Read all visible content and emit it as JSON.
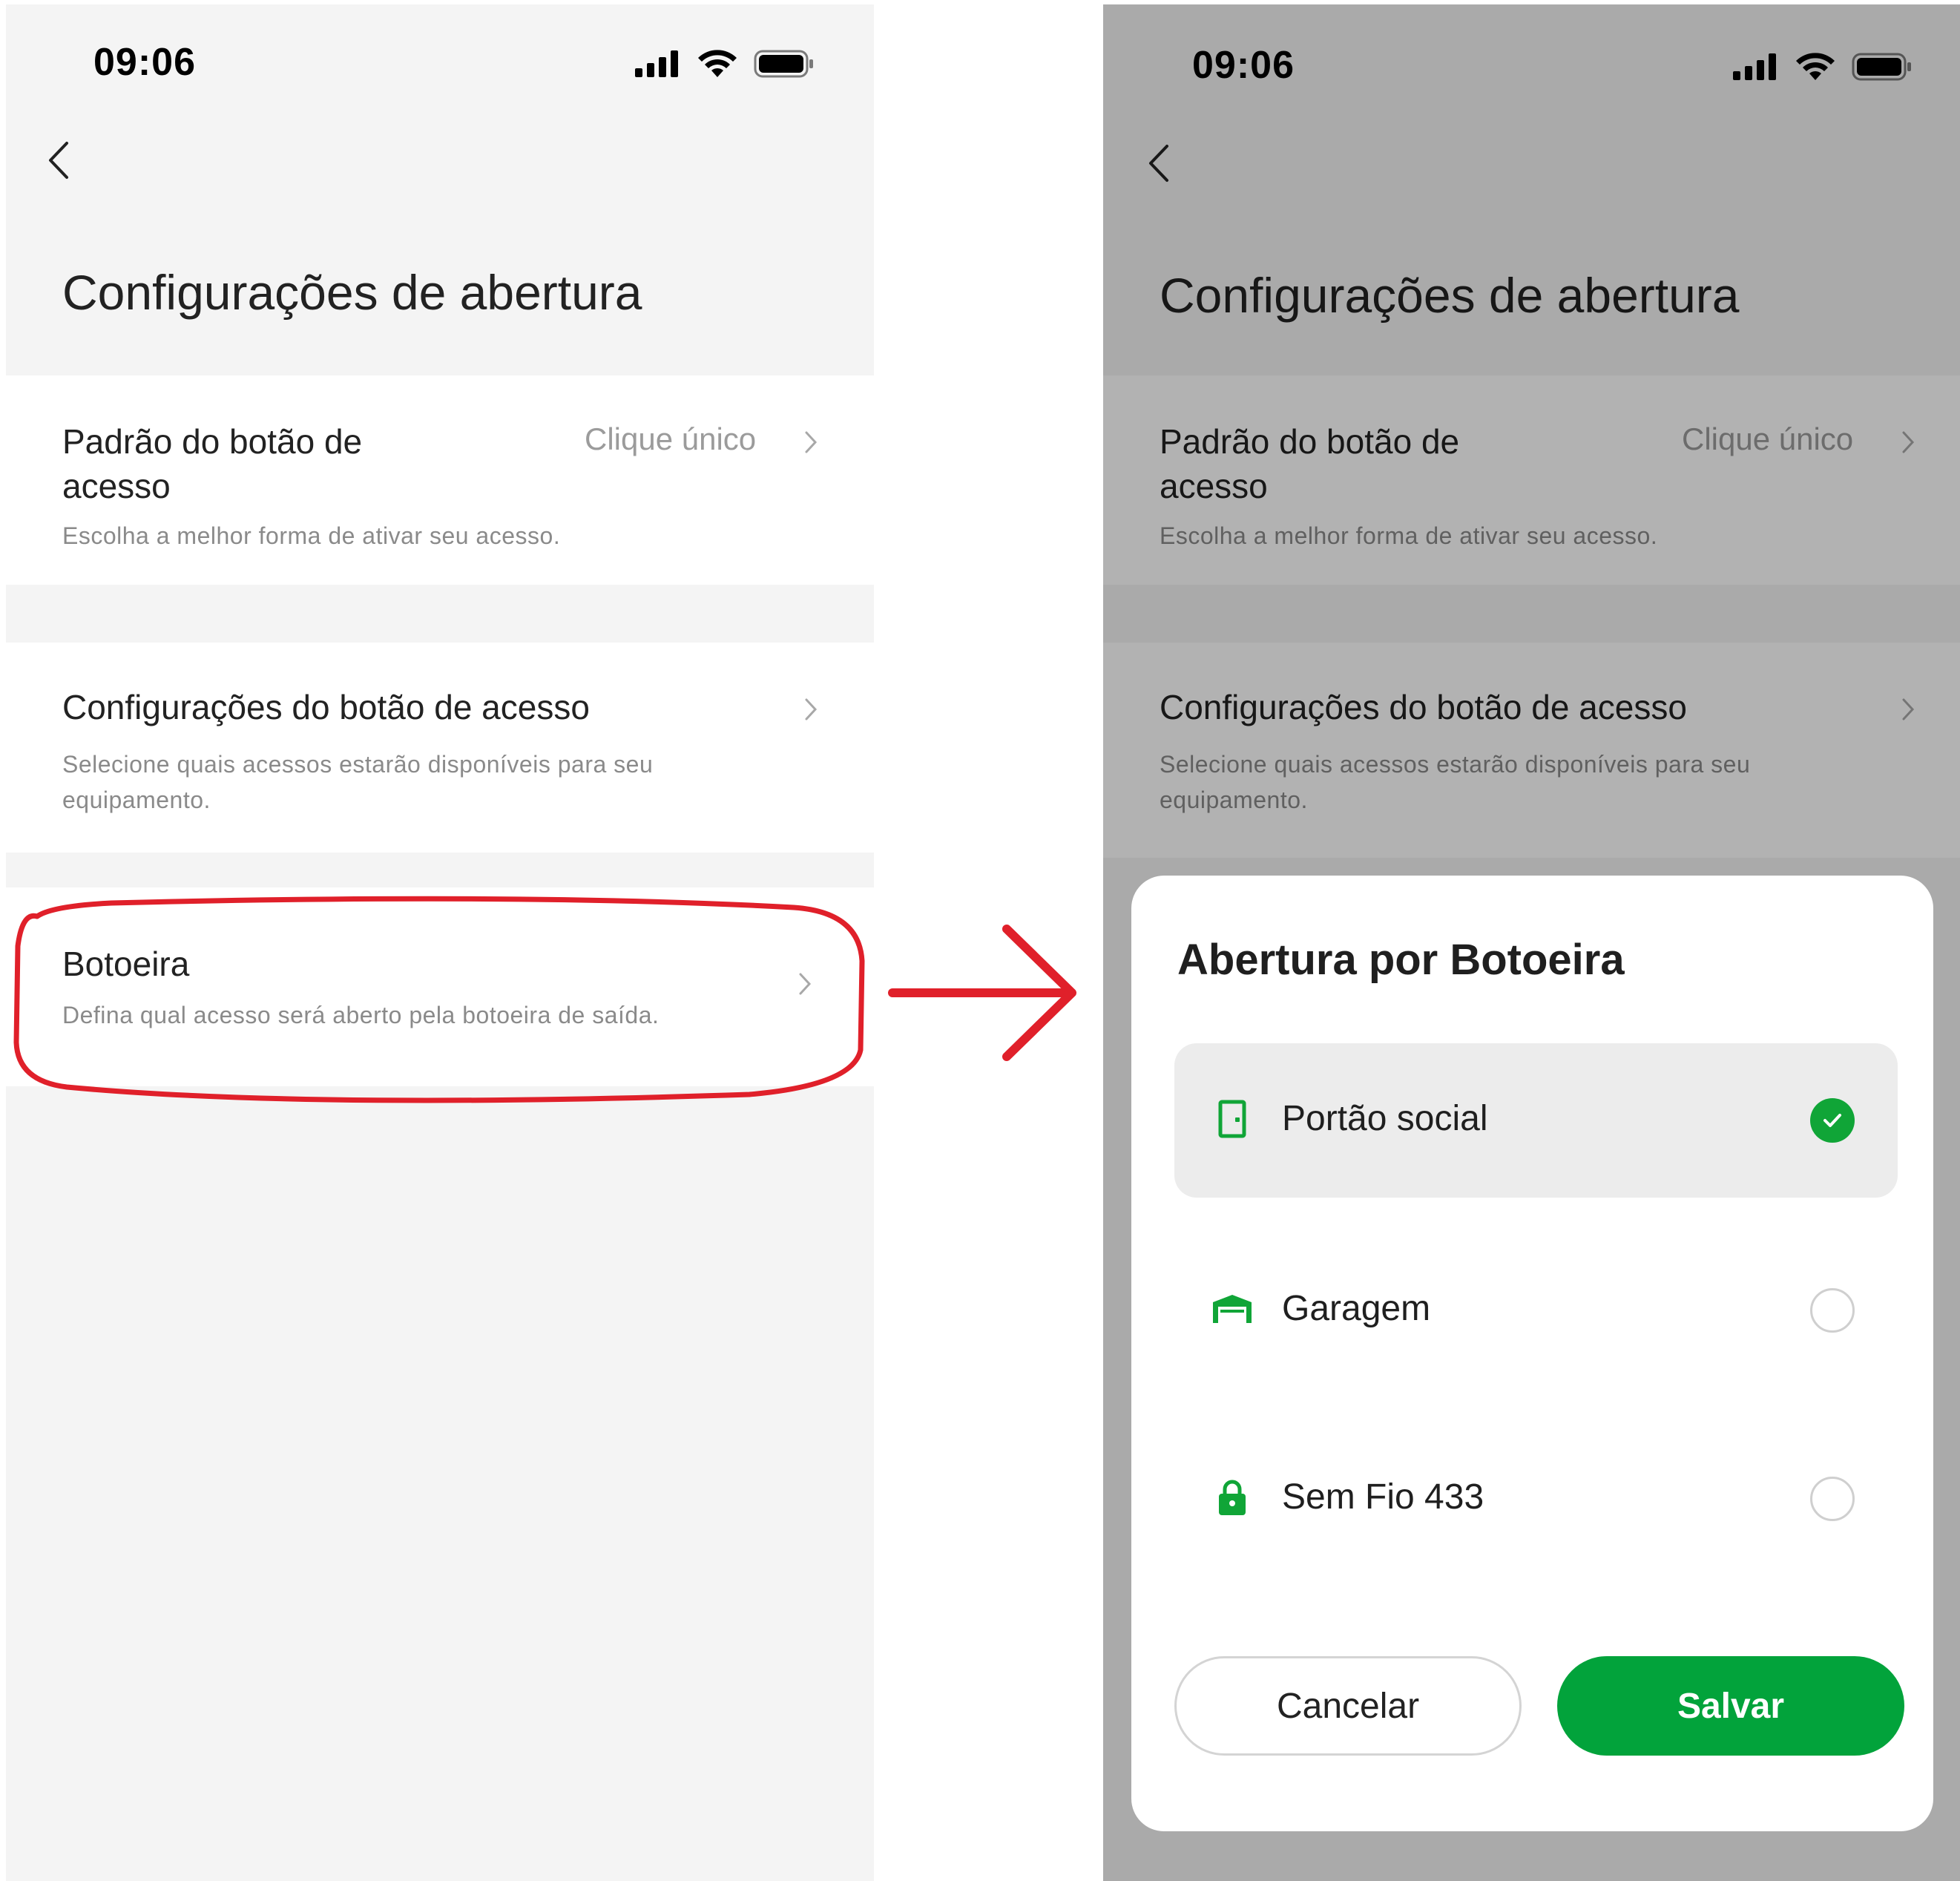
{
  "status": {
    "time": "09:06"
  },
  "left_screen": {
    "title": "Configurações de abertura",
    "rows": [
      {
        "title_line1": "Padrão do botão de",
        "title_line2": "acesso",
        "value": "Clique único",
        "subtitle": "Escolha a melhor forma de ativar seu acesso."
      },
      {
        "title": "Configurações do botão de acesso",
        "subtitle_line1": "Selecione quais acessos estarão disponíveis para seu",
        "subtitle_line2": "equipamento."
      },
      {
        "title": "Botoeira",
        "subtitle": "Defina qual acesso será aberto pela botoeira de saída."
      }
    ]
  },
  "right_screen": {
    "title": "Configurações de abertura",
    "rows": [
      {
        "title_line1": "Padrão do botão de",
        "title_line2": "acesso",
        "value": "Clique único",
        "subtitle": "Escolha a melhor forma de ativar seu acesso."
      },
      {
        "title": "Configurações do botão de acesso",
        "subtitle_line1": "Selecione quais acessos estarão disponíveis para seu",
        "subtitle_line2": "equipamento."
      }
    ],
    "sheet": {
      "title": "Abertura por Botoeira",
      "options": [
        {
          "label": "Portão social",
          "icon": "door-icon",
          "selected": true
        },
        {
          "label": "Garagem",
          "icon": "garage-icon",
          "selected": false
        },
        {
          "label": "Sem Fio 433",
          "icon": "lock-icon",
          "selected": false
        }
      ],
      "cancel_label": "Cancelar",
      "save_label": "Salvar"
    }
  },
  "colors": {
    "accent_green": "#02a33b",
    "annotation_red": "#e0202a",
    "overlay": "rgba(0,0,0,0.30)"
  }
}
